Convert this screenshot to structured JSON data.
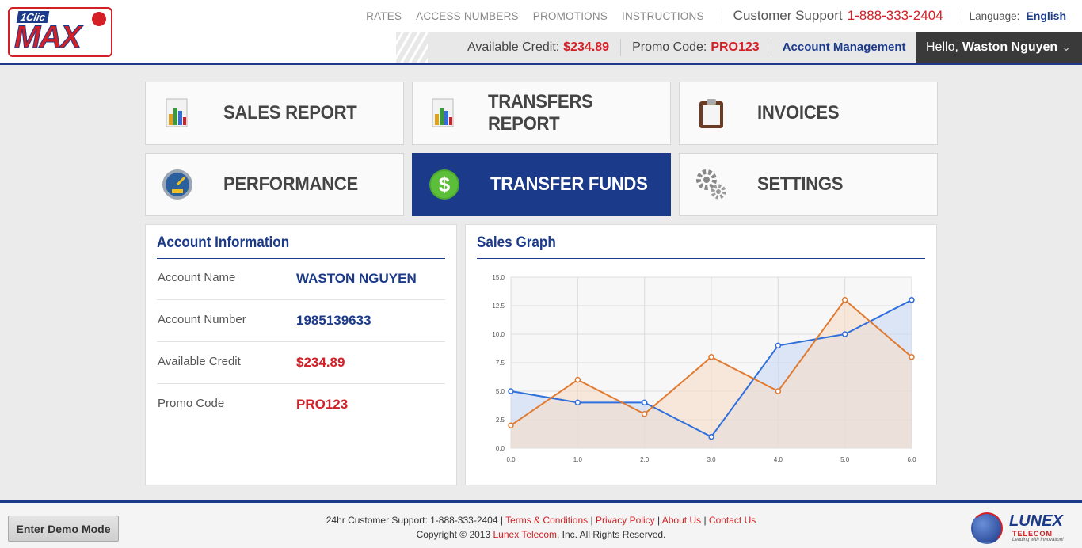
{
  "header": {
    "logo_top": "1Clic",
    "logo_main": "MAX",
    "nav": [
      "RATES",
      "ACCESS NUMBERS",
      "PROMOTIONS",
      "INSTRUCTIONS"
    ],
    "support_label": "Customer Support",
    "support_phone": "1-888-333-2404",
    "language_label": "Language:",
    "language_value": "English",
    "credit_label": "Available Credit:",
    "credit_value": "$234.89",
    "promo_label": "Promo Code:",
    "promo_value": "PRO123",
    "account_mgmt": "Account Management",
    "hello_prefix": "Hello,",
    "hello_name": "Waston Nguyen"
  },
  "tiles": [
    {
      "label": "SALES REPORT",
      "icon": "bar-chart-icon"
    },
    {
      "label": "TRANSFERS REPORT",
      "icon": "bar-chart-icon"
    },
    {
      "label": "INVOICES",
      "icon": "clipboard-icon"
    },
    {
      "label": "PERFORMANCE",
      "icon": "speedometer-icon"
    },
    {
      "label": "TRANSFER FUNDS",
      "icon": "dollar-icon"
    },
    {
      "label": "SETTINGS",
      "icon": "gears-icon"
    }
  ],
  "account": {
    "title": "Account Information",
    "rows": [
      {
        "label": "Account Name",
        "value": "WASTON NGUYEN"
      },
      {
        "label": "Account Number",
        "value": "1985139633"
      },
      {
        "label": "Available Credit",
        "value": "$234.89"
      },
      {
        "label": "Promo Code",
        "value": "PRO123"
      }
    ]
  },
  "graph": {
    "title": "Sales Graph"
  },
  "chart_data": {
    "type": "line",
    "x": [
      0,
      1,
      2,
      3,
      4,
      5,
      6
    ],
    "x_tick_labels": [
      "0.0",
      "1.0",
      "2.0",
      "3.0",
      "4.0",
      "5.0",
      "6.0"
    ],
    "y_tick_labels": [
      "0.0",
      "2.5",
      "5.0",
      "7.5",
      "10.0",
      "12.5",
      "15.0"
    ],
    "ylim": [
      0,
      15
    ],
    "xlim": [
      0,
      6
    ],
    "grid": true,
    "series": [
      {
        "values": [
          5,
          4,
          4,
          1,
          9,
          10,
          13
        ],
        "color": "#2f6fdc",
        "fill": "#c9d9f5"
      },
      {
        "values": [
          2,
          6,
          3,
          8,
          5,
          13,
          8
        ],
        "color": "#e07a30",
        "fill": "#f6dcc8"
      }
    ]
  },
  "footer": {
    "support": "24hr Customer Support: 1-888-333-2404 |",
    "terms": "Terms & Conditions",
    "privacy": "Privacy Policy",
    "about": "About Us",
    "contact": "Contact Us",
    "copyright_prefix": "Copyright © 2013",
    "company": "Lunex Telecom",
    "copyright_suffix": ", Inc. All Rights Reserved.",
    "demo_button": "Enter Demo Mode",
    "brand": "LUNEX",
    "brand_sub": "TELECOM",
    "brand_tag": "Leading with Innovation!"
  }
}
